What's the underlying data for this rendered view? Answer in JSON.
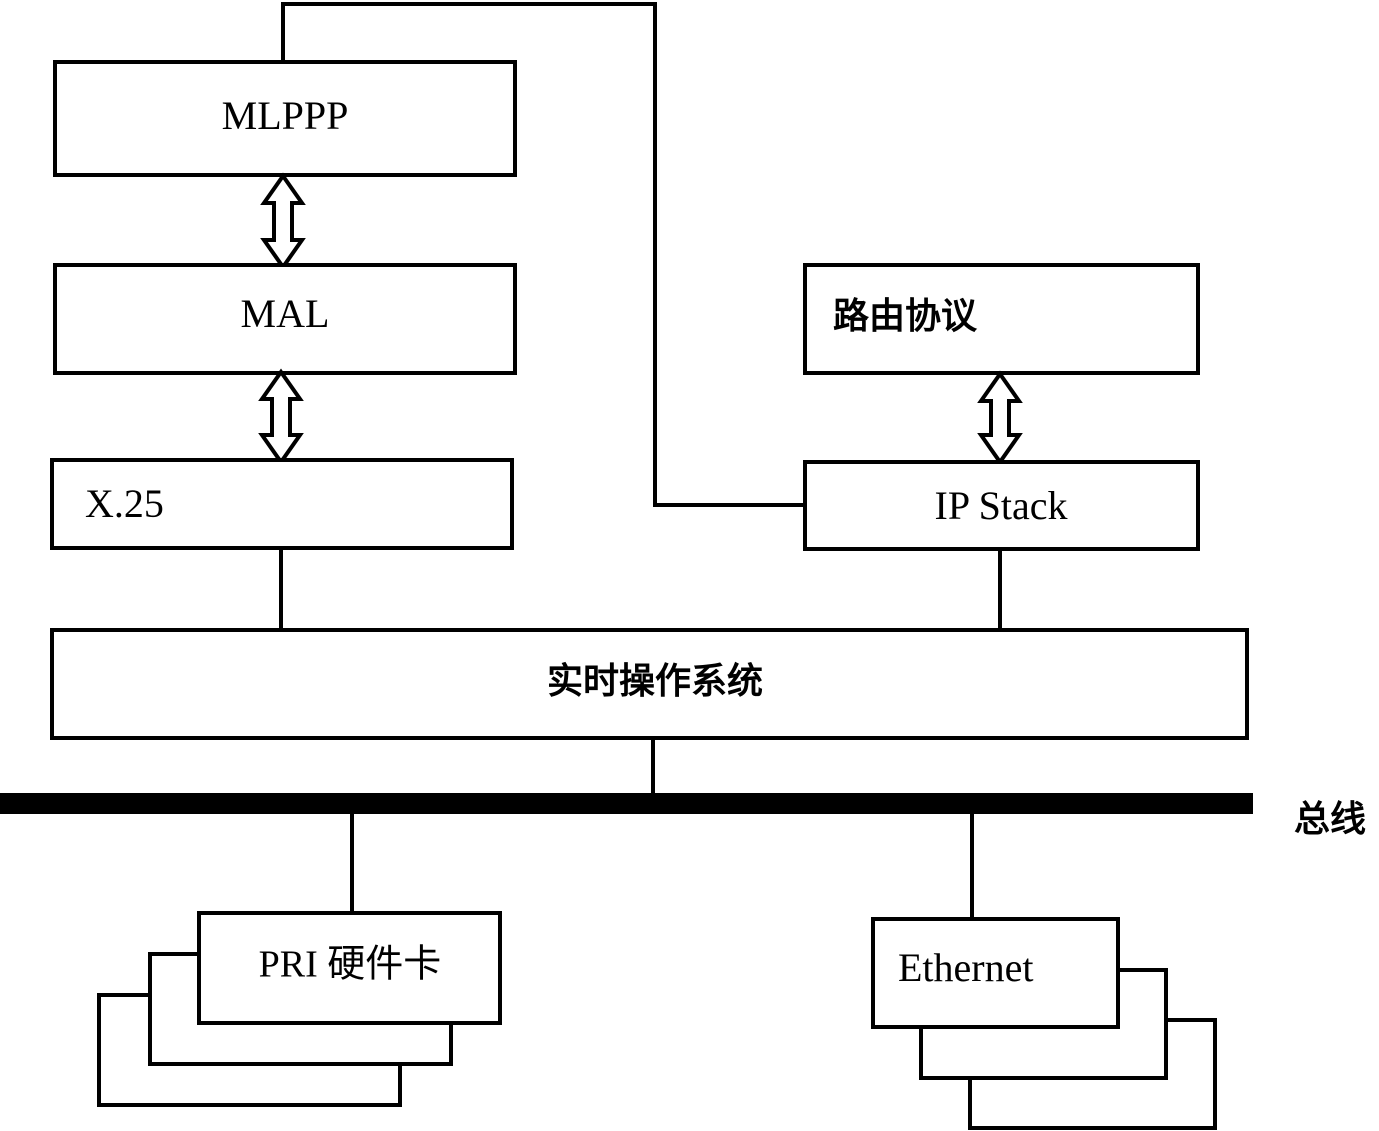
{
  "diagram": {
    "title": "Network device software architecture block diagram",
    "ink_color": "#000000",
    "background_color": "#ffffff",
    "boxes": {
      "mlppp": {
        "label": "MLPPP",
        "align": "center"
      },
      "mal": {
        "label": "MAL",
        "align": "center"
      },
      "x25": {
        "label": "X.25",
        "align": "left"
      },
      "routing_protocol": {
        "label": "路由协议",
        "align": "left"
      },
      "ip_stack": {
        "label": "IP   Stack",
        "align": "center"
      },
      "rtos": {
        "label": "实时操作系统",
        "align": "center"
      },
      "pri_card": {
        "label": "PRI 硬件卡",
        "align": "center"
      },
      "ethernet": {
        "label": "Ethernet",
        "align": "left"
      }
    },
    "bus": {
      "label": "总线",
      "color": "#000000"
    },
    "connectors": [
      {
        "name": "mlppp-to-mal",
        "type": "double-arrow"
      },
      {
        "name": "mal-to-x25",
        "type": "double-arrow"
      },
      {
        "name": "routing-to-ip-stack",
        "type": "double-arrow"
      },
      {
        "name": "mlppp-to-ip-stack",
        "type": "orthogonal-line"
      },
      {
        "name": "x25-to-rtos",
        "type": "line"
      },
      {
        "name": "ip-stack-to-rtos",
        "type": "line"
      },
      {
        "name": "rtos-to-bus",
        "type": "line"
      },
      {
        "name": "bus-to-pri-card",
        "type": "line"
      },
      {
        "name": "bus-to-ethernet",
        "type": "line"
      }
    ],
    "stacks": {
      "pri_card": {
        "copies": 3,
        "offset_direction": "down-left"
      },
      "ethernet": {
        "copies": 3,
        "offset_direction": "down-right"
      }
    }
  }
}
